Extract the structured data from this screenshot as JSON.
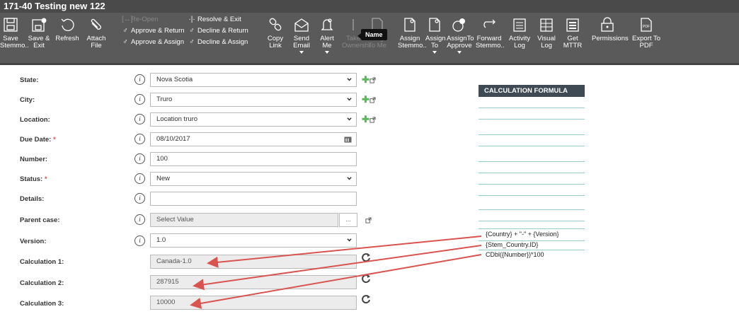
{
  "window": {
    "title": "171-40 Testing new 122"
  },
  "toolbar": {
    "save": "Save Stemmo..",
    "save_exit": "Save & Exit",
    "refresh": "Refresh",
    "attach": "Attach File",
    "reopen": "Re-Open",
    "approve_return": "Approve & Return",
    "approve_assign": "Approve & Assign",
    "resolve_exit": "Resolve & Exit",
    "decline_return": "Decline & Return",
    "decline_assign": "Decline & Assign",
    "copy_link": "Copy Link",
    "send_email": "Send Email",
    "alert_me": "Alert Me",
    "take_ownership": "Take Ownershi",
    "assign_to_me": "Assign To Me",
    "assign_stemmo": "Assign Stemmo..",
    "assign_to": "Assign To",
    "assign_to_approve": "AssignTo Approve",
    "forward_stemmo": "Forward Stemmo..",
    "activity_log": "Activity Log",
    "visual_log": "Visual Log",
    "get_mttr": "Get MTTR",
    "permissions": "Permissions",
    "export_pdf": "Export To PDF",
    "tooltip": "Name",
    "pdf_glyph": "PDF"
  },
  "form": {
    "state": {
      "label": "State:",
      "value": "Nova Scotia"
    },
    "city": {
      "label": "City:",
      "value": "Truro"
    },
    "location": {
      "label": "Location:",
      "value": "Location truro"
    },
    "due_date": {
      "label": "Due Date:",
      "value": "08/10/2017"
    },
    "number": {
      "label": "Number:",
      "value": "100"
    },
    "status": {
      "label": "Status:",
      "value": "New"
    },
    "details": {
      "label": "Details:",
      "value": ""
    },
    "parent_case": {
      "label": "Parent case:",
      "placeholder": "Select Value",
      "button": "..."
    },
    "version": {
      "label": "Version:",
      "value": "1.0"
    },
    "calc1": {
      "label": "Calculation 1:",
      "value": "Canada-1.0"
    },
    "calc2": {
      "label": "Calculation 2:",
      "value": "287915"
    },
    "calc3": {
      "label": "Calculation 3:",
      "value": "10000"
    },
    "required_mark": "*",
    "info_glyph": "i"
  },
  "formula": {
    "header": "CALCULATION FORMULA",
    "rows": [
      "{Country} + \"-\" + {Version}",
      "{Stem_Country.ID}",
      "CDbl({Number})*100"
    ]
  },
  "colors": {
    "arrow": "#d9534f",
    "plus": "#5cb85c",
    "formula_header": "#3f4a55"
  }
}
